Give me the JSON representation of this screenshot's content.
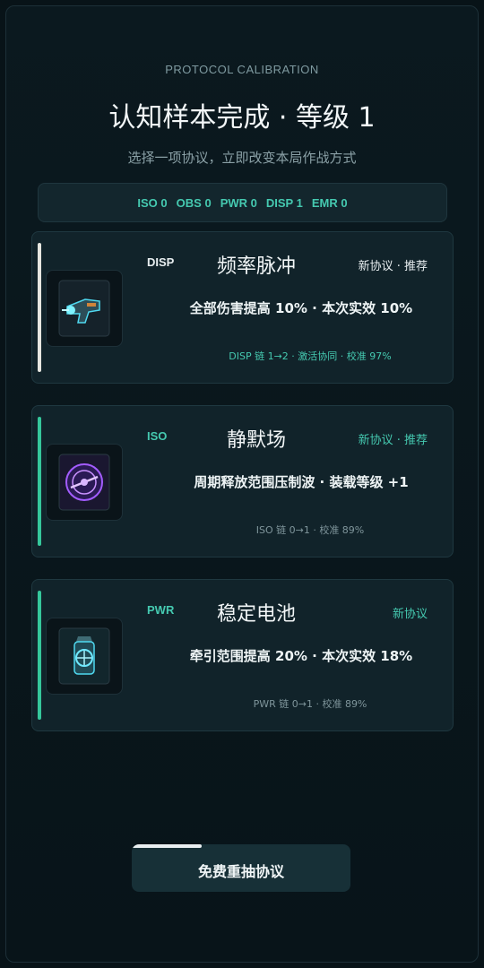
{
  "header": {
    "kicker": "PROTOCOL CALIBRATION",
    "title": "认知样本完成 · 等级 1",
    "subtitle": "选择一项协议，立即改变本局作战方式"
  },
  "stats": [
    {
      "label": "ISO",
      "value": "0"
    },
    {
      "label": "OBS",
      "value": "0"
    },
    {
      "label": "PWR",
      "value": "0"
    },
    {
      "label": "DISP",
      "value": "1"
    },
    {
      "label": "EMR",
      "value": "0"
    }
  ],
  "cards": [
    {
      "category": "DISP",
      "name": "频率脉冲",
      "badge": "新协议 · 推荐",
      "effect": "全部伤害提高 10% · 本次实效 10%",
      "chain": "DISP 链 1→2 · 激活协同 · 校准 97%",
      "icon": "pulse-blaster-icon",
      "accent_color": "#e6e6e0",
      "category_color": "#e8eef0",
      "badge_color": "#e8eef0",
      "chain_color": "#45c9b0"
    },
    {
      "category": "ISO",
      "name": "静默场",
      "badge": "新协议 · 推荐",
      "effect": "周期释放范围压制波 · 装载等级 +1",
      "chain": "ISO 链 0→1 · 校准 89%",
      "icon": "silence-field-icon",
      "accent_color": "#35c79b",
      "category_color": "#45c9b0",
      "badge_color": "#45c9b0",
      "chain_color": "#7f959b"
    },
    {
      "category": "PWR",
      "name": "稳定电池",
      "badge": "新协议",
      "effect": "牵引范围提高 20% · 本次实效 18%",
      "chain": "PWR 链 0→1 · 校准 89%",
      "icon": "stable-battery-icon",
      "accent_color": "#35c79b",
      "category_color": "#45c9b0",
      "badge_color": "#45c9b0",
      "chain_color": "#7f959b"
    }
  ],
  "reroll": {
    "label": "免费重抽协议",
    "progress": 0.32
  }
}
